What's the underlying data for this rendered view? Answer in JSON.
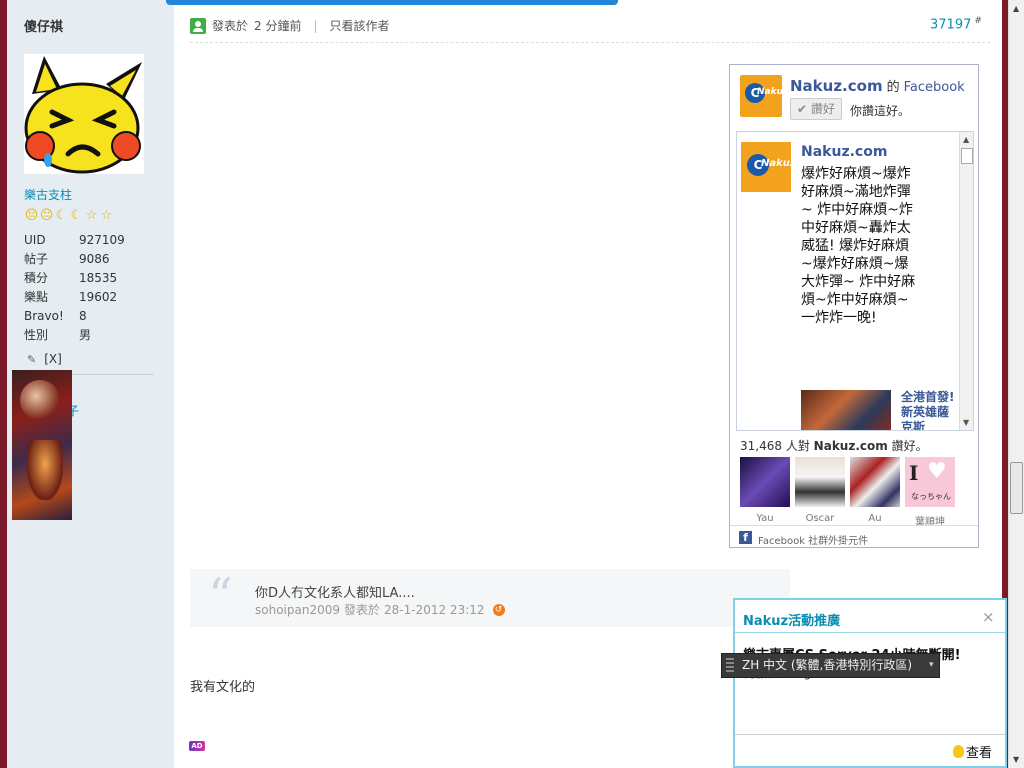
{
  "author": {
    "name": "傻仔祺",
    "rank_title": "樂古支柱",
    "stats": [
      {
        "key": "UID",
        "value": "927109"
      },
      {
        "key": "帖子",
        "value": "9086"
      },
      {
        "key": "積分",
        "value": "18535"
      },
      {
        "key": "樂點",
        "value": "19602"
      },
      {
        "key": "Bravo!",
        "value": "8"
      },
      {
        "key": "性別",
        "value": "男"
      }
    ],
    "close_label": "[X]",
    "link_fragment": "子"
  },
  "post": {
    "posted_label": "發表於",
    "posted_time": "2 分鐘前",
    "author_only_label": "只看該作者",
    "post_number": "37197",
    "post_number_suffix": "#"
  },
  "facebook": {
    "page_name": "Nakuz.com",
    "of_label": "的",
    "network": "Facebook",
    "like_button": "讚好",
    "you_like_text": "你讚這好。",
    "feed_name": "Nakuz.com",
    "feed_message": "爆炸好麻煩~爆炸好麻煩~滿地炸彈~ 炸中好麻煩~炸中好麻煩~轟炸太威猛! 爆炸好麻煩~爆炸好麻煩~爆大炸彈~ 炸中好麻煩~炸中好麻煩~一炸炸一晚!",
    "feed_link": "全港首發!新英雄薩克斯",
    "like_count": "31,468",
    "like_count_mid": "人對",
    "like_count_end": "讚好。",
    "faces": [
      {
        "name": "Yau"
      },
      {
        "name": "Oscar"
      },
      {
        "name": "Au"
      },
      {
        "name": "葉順坤"
      }
    ],
    "face4_text": "なっちゃん",
    "footer": "Facebook 社群外掛元件"
  },
  "quote": {
    "text": "你D人冇文化系人都知LA....",
    "author": "sohoipan2009",
    "posted_label": "發表於",
    "time": "28-1-2012 23:12"
  },
  "reply": {
    "text": "我有文化的"
  },
  "ad_badge": "AD",
  "promo": {
    "title": "Nakuz活動推廣",
    "close": "×",
    "headline": "樂古專屬CS Server 24小時無斷開!",
    "subline": "伺服器: cs.gamerclub.net:27035",
    "more": "查看"
  },
  "ime": {
    "text": "ZH 中文 (繁體,香港特別行政區)"
  }
}
